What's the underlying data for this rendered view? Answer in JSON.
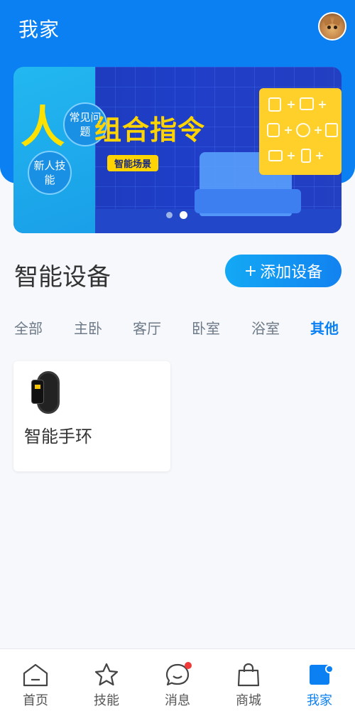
{
  "header": {
    "title": "我家",
    "avatar_icon": "cat-avatar-icon"
  },
  "banner": {
    "big_char": "人",
    "bubble_faq": "常见问题",
    "bubble_newbie": "新人技能",
    "title": "组合指令",
    "tag": "智能场景",
    "screen_icons": "☐+☐+ 🔒+◷+☐ ◎+▯+☐",
    "page_count": 2,
    "active_page": 2
  },
  "section": {
    "title": "智能设备",
    "add_button_plus": "+",
    "add_button_label": "添加设备"
  },
  "tabs": [
    {
      "label": "全部",
      "active": false
    },
    {
      "label": "主卧",
      "active": false
    },
    {
      "label": "客厅",
      "active": false
    },
    {
      "label": "卧室",
      "active": false
    },
    {
      "label": "浴室",
      "active": false
    },
    {
      "label": "其他",
      "active": true
    }
  ],
  "devices": [
    {
      "name": "智能手环",
      "icon": "smart-band-icon"
    }
  ],
  "bottom_nav": [
    {
      "label": "首页",
      "icon": "home-icon",
      "active": false
    },
    {
      "label": "技能",
      "icon": "star-icon",
      "active": false
    },
    {
      "label": "消息",
      "icon": "message-icon",
      "active": false,
      "has_badge": true
    },
    {
      "label": "商城",
      "icon": "shopping-bag-icon",
      "active": false
    },
    {
      "label": "我家",
      "icon": "my-home-icon",
      "active": true,
      "has_badge": true
    }
  ],
  "colors": {
    "primary": "#0a80f2",
    "badge": "#f03a3a",
    "banner_yellow": "#ffd400"
  }
}
